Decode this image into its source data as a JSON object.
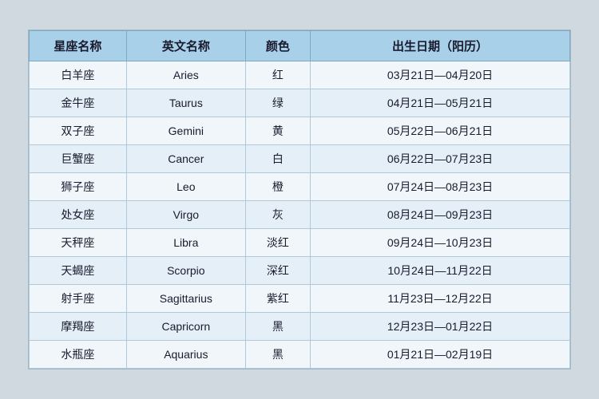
{
  "table": {
    "headers": {
      "chinese_name": "星座名称",
      "english_name": "英文名称",
      "color": "颜色",
      "birthdate": "出生日期（阳历）"
    },
    "rows": [
      {
        "chinese": "白羊座",
        "english": "Aries",
        "color": "红",
        "date": "03月21日—04月20日"
      },
      {
        "chinese": "金牛座",
        "english": "Taurus",
        "color": "绿",
        "date": "04月21日—05月21日"
      },
      {
        "chinese": "双子座",
        "english": "Gemini",
        "color": "黄",
        "date": "05月22日—06月21日"
      },
      {
        "chinese": "巨蟹座",
        "english": "Cancer",
        "color": "白",
        "date": "06月22日—07月23日"
      },
      {
        "chinese": "狮子座",
        "english": "Leo",
        "color": "橙",
        "date": "07月24日—08月23日"
      },
      {
        "chinese": "处女座",
        "english": "Virgo",
        "color": "灰",
        "date": "08月24日—09月23日"
      },
      {
        "chinese": "天秤座",
        "english": "Libra",
        "color": "淡红",
        "date": "09月24日—10月23日"
      },
      {
        "chinese": "天蝎座",
        "english": "Scorpio",
        "color": "深红",
        "date": "10月24日—11月22日"
      },
      {
        "chinese": "射手座",
        "english": "Sagittarius",
        "color": "紫红",
        "date": "11月23日—12月22日"
      },
      {
        "chinese": "摩羯座",
        "english": "Capricorn",
        "color": "黑",
        "date": "12月23日—01月22日"
      },
      {
        "chinese": "水瓶座",
        "english": "Aquarius",
        "color": "黑",
        "date": "01月21日—02月19日"
      }
    ]
  }
}
